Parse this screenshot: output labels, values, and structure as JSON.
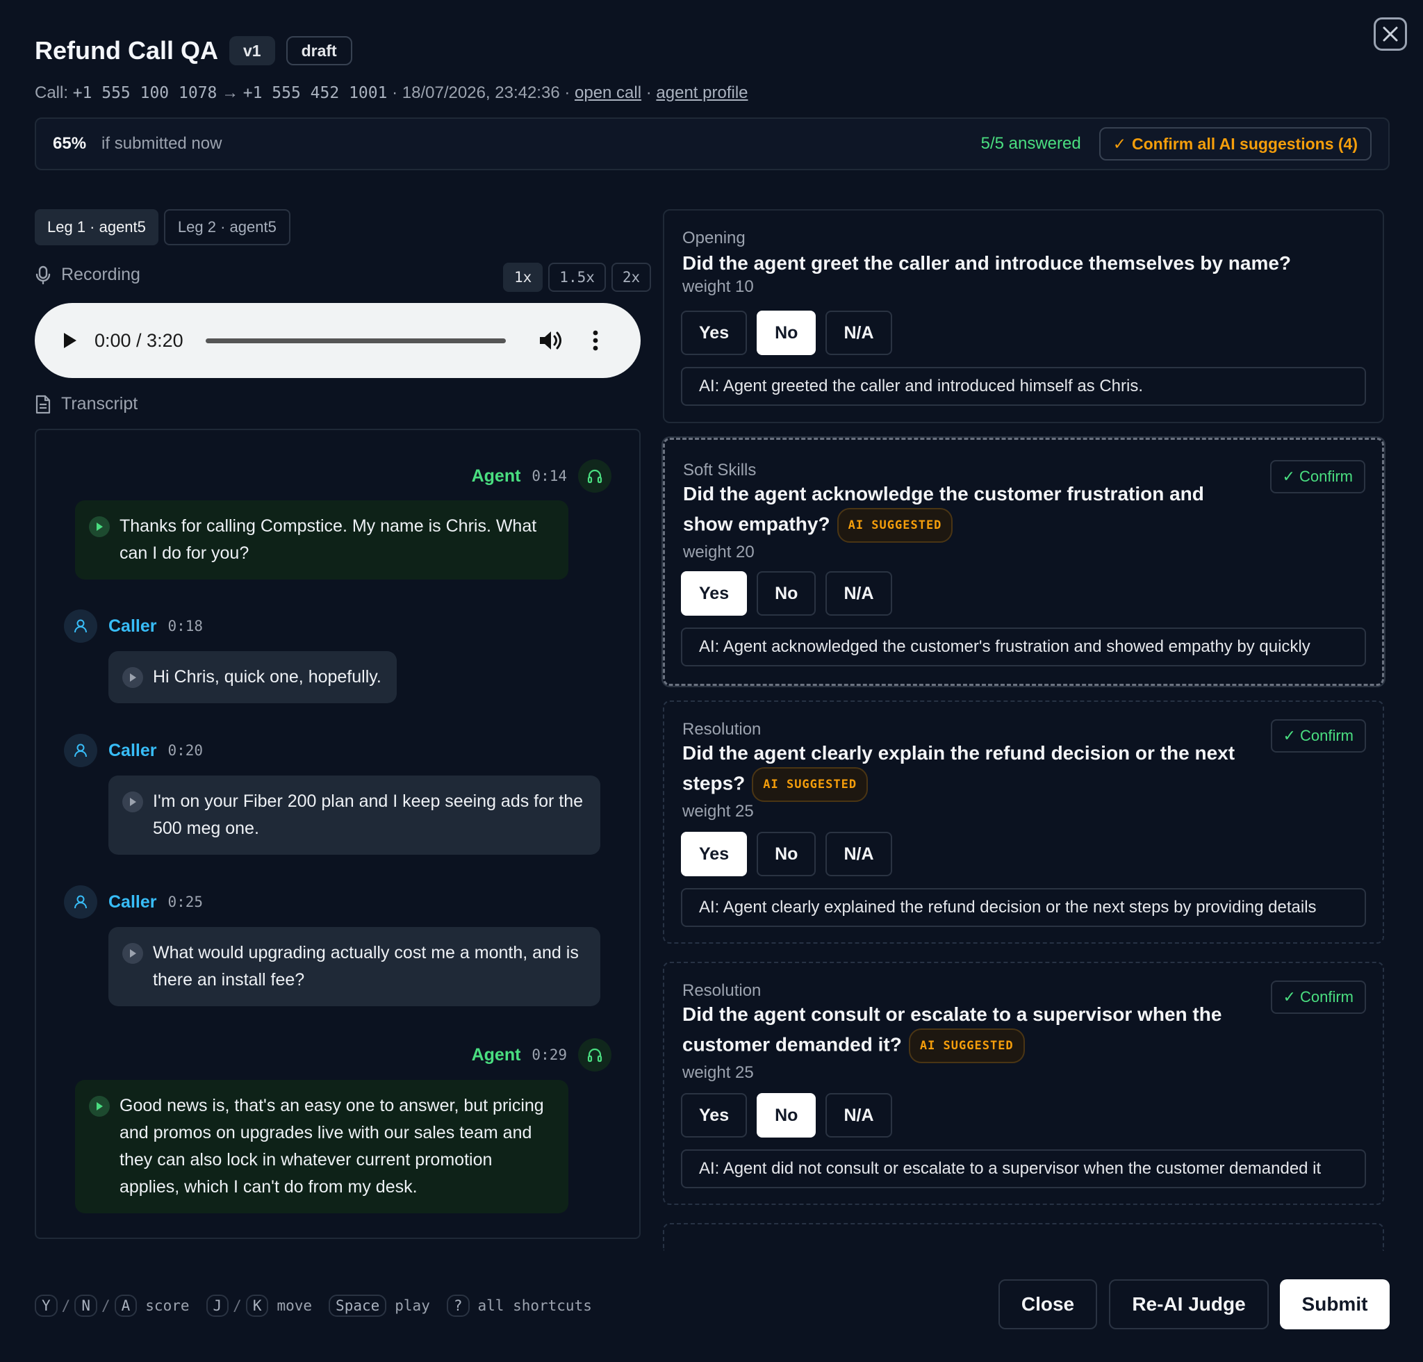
{
  "header": {
    "title": "Refund Call QA",
    "version_chip": "v1",
    "status_chip": "draft",
    "meta_prefix": "Call: ",
    "from_number": "+1 555 100 1078",
    "arrow": " → ",
    "to_number": "+1 555 452 1001",
    "meta_date": " · 18/07/2026, 23:42:36 · ",
    "open_call_link": "open call",
    "dot": " · ",
    "agent_profile_link": "agent profile"
  },
  "score": {
    "percent": "65%",
    "subtext": "if submitted now",
    "answered": "5/5 answered",
    "confirm_all": "Confirm all AI suggestions (4)"
  },
  "legs": [
    {
      "label": "Leg 1 · agent5",
      "active": true
    },
    {
      "label": "Leg 2 · agent5",
      "active": false
    }
  ],
  "recording": {
    "label": "Recording",
    "speeds": [
      "1x",
      "1.5x",
      "2x"
    ],
    "active_speed": "1x",
    "time": "0:00 / 3:20"
  },
  "transcript": {
    "label": "Transcript",
    "turns": [
      {
        "speaker": "Agent",
        "time": "0:14",
        "text": "Thanks for calling Compstice. My name is Chris. What can I do for you?"
      },
      {
        "speaker": "Caller",
        "time": "0:18",
        "text": "Hi Chris, quick one, hopefully."
      },
      {
        "speaker": "Caller",
        "time": "0:20",
        "text": "I'm on your Fiber 200 plan and I keep seeing ads for the 500 meg one."
      },
      {
        "speaker": "Caller",
        "time": "0:25",
        "text": "What would upgrading actually cost me a month, and is there an install fee?"
      },
      {
        "speaker": "Agent",
        "time": "0:29",
        "text": "Good news is, that's an easy one to answer, but pricing and promos on upgrades live with our sales team and they can also lock in whatever current promotion applies, which I can't do from my desk."
      }
    ]
  },
  "questions": [
    {
      "category": "Opening",
      "text": "Did the agent greet the caller and introduce themselves by name?",
      "weight": "weight 10",
      "selected": "No",
      "ai_suggested": false,
      "ai_note": "AI: Agent greeted the caller and introduced himself as Chris."
    },
    {
      "category": "Soft Skills",
      "text": "Did the agent acknowledge the customer frustration and show empathy?",
      "weight": "weight 20",
      "selected": "Yes",
      "ai_suggested": true,
      "ai_note": "AI: Agent acknowledged the customer's frustration and showed empathy by quickly"
    },
    {
      "category": "Resolution",
      "text": "Did the agent clearly explain the refund decision or the next steps?",
      "weight": "weight 25",
      "selected": "Yes",
      "ai_suggested": true,
      "ai_note": "AI: Agent clearly explained the refund decision or the next steps by providing details"
    },
    {
      "category": "Resolution",
      "text": "Did the agent consult or escalate to a supervisor when the customer demanded it?",
      "weight": "weight 25",
      "selected": "No",
      "ai_suggested": true,
      "ai_note": "AI: Agent did not consult or escalate to a supervisor when the customer demanded it"
    }
  ],
  "options": [
    "Yes",
    "No",
    "N/A"
  ],
  "ai_badge": "AI SUGGESTED",
  "confirm_label": "Confirm",
  "shortcuts": {
    "k_y": "Y",
    "k_n": "N",
    "k_a": "A",
    "score": "score",
    "k_j": "J",
    "k_k": "K",
    "move": "move",
    "k_space": "Space",
    "play": "play",
    "k_q": "?",
    "all": "all shortcuts",
    "slash": "/"
  },
  "footer": {
    "close": "Close",
    "rejudge": "Re-AI Judge",
    "submit": "Submit"
  },
  "colors": {
    "agent": "#4ade80",
    "caller": "#38bdf8",
    "accent_warning": "#f59e0b",
    "background": "#0b1220"
  }
}
